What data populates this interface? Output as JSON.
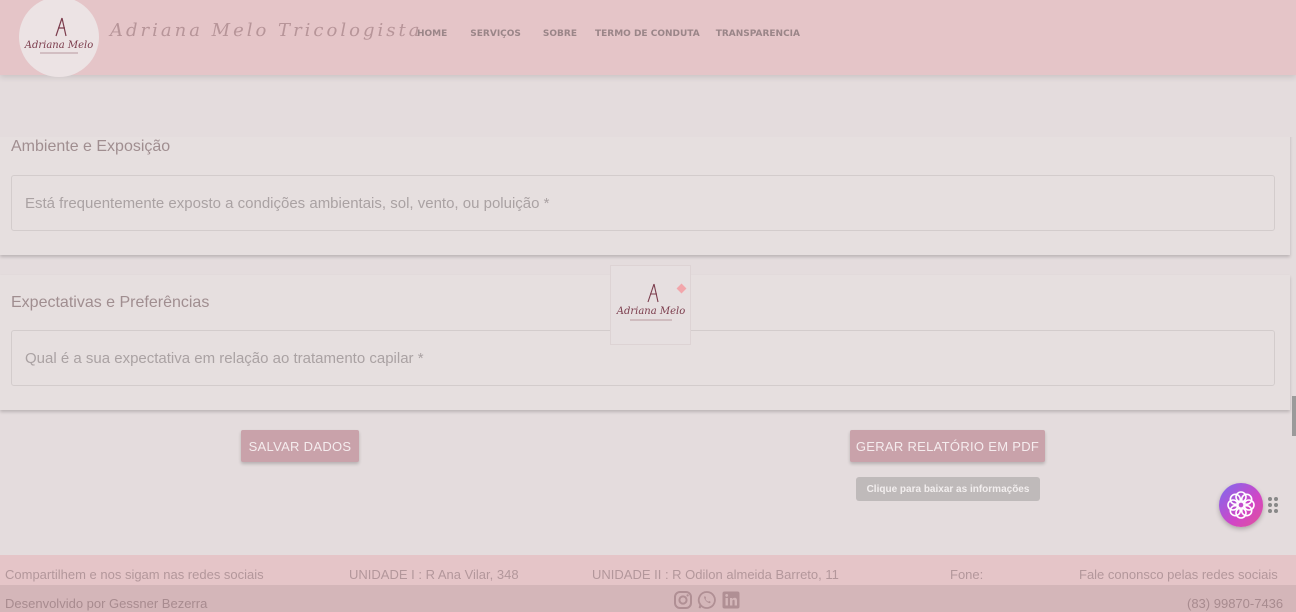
{
  "header": {
    "brand_name": "Adriana Melo Tricologista",
    "logo_text": "Adriana Melo",
    "nav": [
      "HOME",
      "SERVIÇOS",
      "SOBRE",
      "TERMO DE CONDUTA",
      "TRANSPARENCIA"
    ]
  },
  "sections": [
    {
      "title": "Ambiente e Exposição",
      "field_placeholder": "Está frequentemente exposto a condições ambientais, sol, vento, ou poluição *"
    },
    {
      "title": "Expectativas e Preferências",
      "field_placeholder": "Qual é a sua expectativa em relação ao tratamento capilar *"
    }
  ],
  "center_logo_text": "Adriana Melo",
  "buttons": {
    "save": "SALVAR DADOS",
    "pdf": "GERAR RELATÓRIO EM PDF",
    "pdf_tooltip": "Clique para baixar as informações"
  },
  "footer": {
    "share": "Compartilhem e nos sigam nas redes sociais",
    "unit1": "UNIDADE I : R Ana Vilar, 348",
    "unit2": "UNIDADE II : R Odilon almeida Barreto, 11",
    "phone_label": "Fone:",
    "contact": "Fale cononsco pelas redes sociais",
    "developer": "Desenvolvido por Gessner Bezerra",
    "phone": "(83) 99870-7436"
  },
  "icons": [
    "instagram-icon",
    "whatsapp-icon",
    "linkedin-icon",
    "flower-widget-icon",
    "drag-handle-icon"
  ],
  "colors": {
    "header_bg": "#e5c5c8",
    "accent": "#c9a2aa",
    "page_bg": "#e4dcdd"
  }
}
